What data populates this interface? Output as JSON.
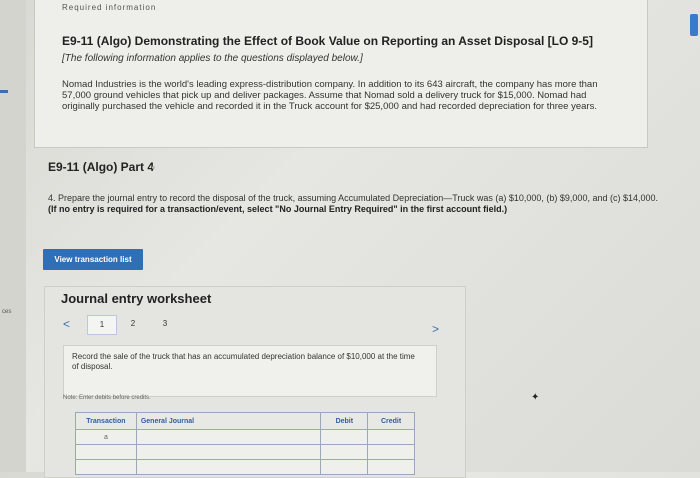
{
  "header": {
    "cut_heading": "Required information",
    "title": "E9-11 (Algo) Demonstrating the Effect of Book Value on Reporting an Asset Disposal [LO 9-5]",
    "subtitle": "[The following information applies to the questions displayed below.]",
    "paragraph": "Nomad Industries is the world's leading express-distribution company. In addition to its 643 aircraft, the company has more than 57,000 ground vehicles that pick up and deliver packages. Assume that Nomad sold a delivery truck for $15,000. Nomad had originally purchased the vehicle and recorded it in the Truck account for $25,000 and had recorded depreciation for three years."
  },
  "part": {
    "heading": "E9-11 (Algo) Part 4",
    "question_plain": "4. Prepare the journal entry to record the disposal of the truck, assuming Accumulated Depreciation—Truck was (a) $10,000, (b) $9,000, and (c) $14,000.",
    "question_bold": "(If no entry is required for a transaction/event, select \"No Journal Entry Required\" in the first account field.)"
  },
  "buttons": {
    "view_transaction_list": "View transaction list"
  },
  "worksheet": {
    "title": "Journal entry worksheet",
    "prev_icon": "<",
    "next_icon": ">",
    "tabs": [
      "1",
      "2",
      "3"
    ],
    "description": "Record the sale of the truck that has an accumulated depreciation balance of $10,000 at the time of disposal.",
    "note": "Note: Enter debits before credits.",
    "table": {
      "headers": [
        "Transaction",
        "General Journal",
        "Debit",
        "Credit"
      ],
      "rows": [
        [
          "a",
          "",
          "",
          ""
        ],
        [
          "",
          "",
          "",
          ""
        ],
        [
          "",
          "",
          "",
          ""
        ]
      ]
    }
  },
  "sidebar": {
    "side_label": "ces"
  },
  "colors": {
    "accent": "#2f6fb6",
    "link": "#3a6fb0"
  }
}
